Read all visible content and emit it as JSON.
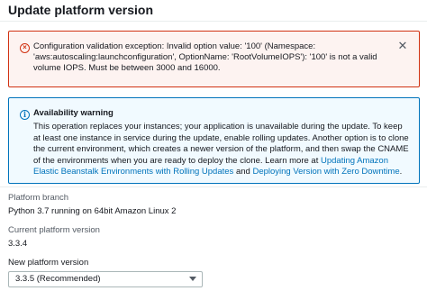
{
  "modal": {
    "title": "Update platform version"
  },
  "error_alert": {
    "icon": "error-circle-icon",
    "message": "Configuration validation exception: Invalid option value: '100' (Namespace: 'aws:autoscaling:launchconfiguration', OptionName: 'RootVolumeIOPS'): '100' is not a valid volume IOPS. Must be between 3000 and 16000.",
    "close_icon": "close-icon",
    "close_symbol": "✕"
  },
  "info_alert": {
    "icon": "info-circle-icon",
    "title": "Availability warning",
    "body_text": "This operation replaces your instances; your application is unavailable during the update. To keep at least one instance in service during the update, enable rolling updates. Another option is to clone the current environment, which creates a newer version of the platform, and then swap the CNAME of the environments when you are ready to deploy the clone. Learn more at ",
    "link1": "Updating Amazon Elastic Beanstalk Environments with Rolling Updates",
    "conjunction": " and ",
    "link2": "Deploying Version with Zero Downtime",
    "end": "."
  },
  "platform_branch": {
    "label": "Platform branch",
    "value": "Python 3.7 running on 64bit Amazon Linux 2"
  },
  "current_version": {
    "label": "Current platform version",
    "value": "3.3.4"
  },
  "new_version": {
    "label": "New platform version",
    "selected": "3.3.5 (Recommended)"
  },
  "colors": {
    "error": "#d13212",
    "info": "#0073bb",
    "link": "#0073bb"
  }
}
